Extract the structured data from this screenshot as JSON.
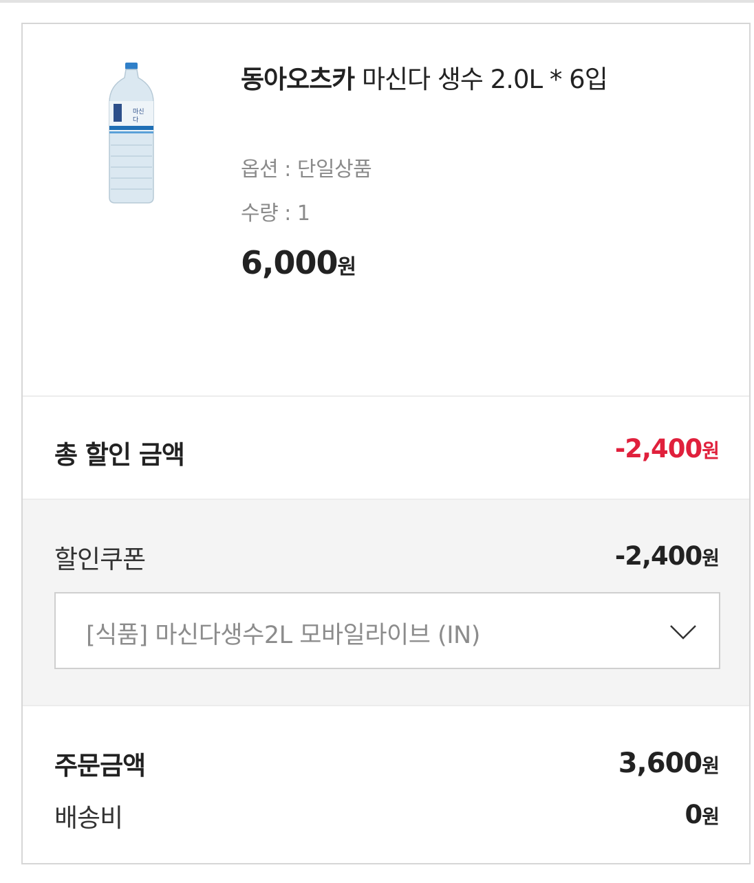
{
  "product": {
    "image_alt": "water-bottle-image",
    "brand": "동아오츠카",
    "name": " 마신다 생수 2.0L * 6입",
    "option_label": "옵션 : 단일상품",
    "quantity_label": "수량 : 1",
    "price": "6,000",
    "price_unit": "원"
  },
  "discount_total": {
    "label": "총 할인 금액",
    "value": "-2,400",
    "unit": "원",
    "color": "#e0203c"
  },
  "coupon": {
    "label": "할인쿠폰",
    "value": "-2,400",
    "unit": "원",
    "selected": "[식품] 마신다생수2L 모바일라이브 (IN)",
    "dropdown_icon": "chevron-down-icon"
  },
  "order": {
    "label": "주문금액",
    "value": "3,600",
    "unit": "원"
  },
  "shipping": {
    "label": "배송비",
    "value": "0",
    "unit": "원"
  }
}
